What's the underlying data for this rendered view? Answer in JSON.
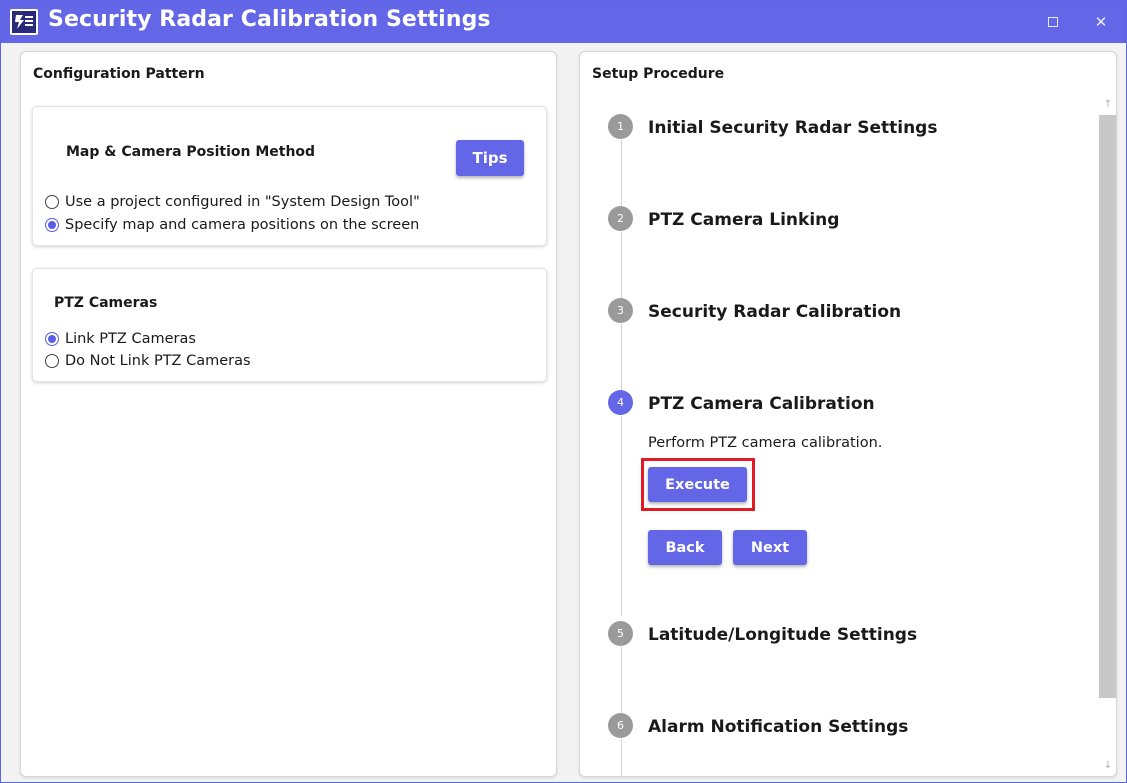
{
  "window": {
    "title": "Security Radar Calibration Settings",
    "close_glyph": "✕"
  },
  "left": {
    "title": "Configuration Pattern",
    "map_card": {
      "title": "Map & Camera Position Method",
      "tips_label": "Tips",
      "options": [
        {
          "label": "Use a project configured in \"System Design Tool\"",
          "checked": false
        },
        {
          "label": "Specify map and camera positions on the screen",
          "checked": true
        }
      ]
    },
    "ptz_card": {
      "title": "PTZ Cameras",
      "options": [
        {
          "label": "Link PTZ Cameras",
          "checked": true
        },
        {
          "label": "Do Not Link PTZ Cameras",
          "checked": false
        }
      ]
    }
  },
  "right": {
    "title": "Setup Procedure",
    "steps": [
      {
        "number": "1",
        "label": "Initial Security Radar Settings",
        "active": false
      },
      {
        "number": "2",
        "label": "PTZ Camera Linking",
        "active": false
      },
      {
        "number": "3",
        "label": "Security Radar Calibration",
        "active": false
      },
      {
        "number": "4",
        "label": "PTZ Camera Calibration",
        "active": true
      },
      {
        "number": "5",
        "label": "Latitude/Longitude Settings",
        "active": false
      },
      {
        "number": "6",
        "label": "Alarm Notification Settings",
        "active": false
      }
    ],
    "active_step": {
      "description": "Perform PTZ camera calibration.",
      "execute_label": "Execute",
      "back_label": "Back",
      "next_label": "Next"
    },
    "scroll": {
      "up_glyph": "↑",
      "down_glyph": "↓"
    }
  },
  "colors": {
    "accent": "#6366e6",
    "highlight": "#e01b24",
    "inactive_step": "#9a9a9a"
  }
}
